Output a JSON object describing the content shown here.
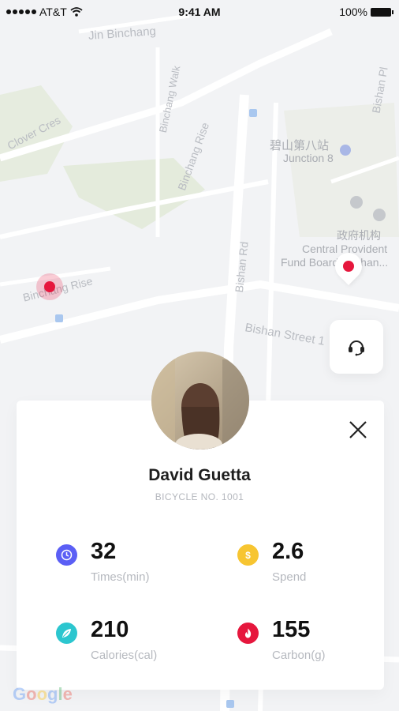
{
  "status_bar": {
    "carrier": "AT&T",
    "time": "9:41 AM",
    "battery": "100%"
  },
  "map": {
    "labels": {
      "jin_binchang": "Jin Binchang",
      "binchang_walk": "Binchang Walk",
      "clover_cres": "Clover Cres",
      "binchang_rise_diag": "Binchang Rise",
      "binchang_rise_left": "Binchang Rise",
      "bishan_rd": "Bishan Rd",
      "bishan_pl": "Bishan Pl",
      "junction8_cn": "碧山第八站",
      "junction8": "Junction 8",
      "gov_cn": "政府机构",
      "cpf_1": "Central Provident",
      "cpf_2": "Fund Board (Bishan...",
      "bishan_st": "Bishan Street 1",
      "google": "Google"
    }
  },
  "rider": {
    "name": "David Guetta",
    "bicycle": "BICYCLE NO. 1001"
  },
  "stats": [
    {
      "value": "32",
      "label": "Times(min)",
      "icon": "clock-icon",
      "color": "#5b5ff5"
    },
    {
      "value": "2.6",
      "label": "Spend",
      "icon": "dollar-icon",
      "color": "#f7c531"
    },
    {
      "value": "210",
      "label": "Calories(cal)",
      "icon": "leaf-icon",
      "color": "#2cc6cf"
    },
    {
      "value": "155",
      "label": "Carbon(g)",
      "icon": "flame-icon",
      "color": "#e6173d"
    }
  ]
}
